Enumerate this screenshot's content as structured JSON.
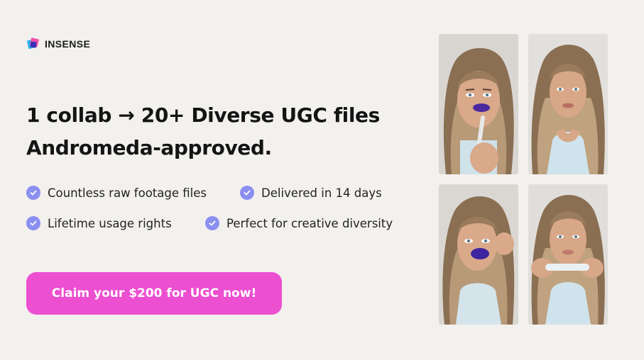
{
  "brand": {
    "name": "INSENSE"
  },
  "headline": {
    "line1": "1 collab → 20+ Diverse UGC files",
    "line2": "Andromeda-approved."
  },
  "features": [
    {
      "label": "Countless raw footage files",
      "icon": "check-circle-icon"
    },
    {
      "label": "Delivered in 14 days",
      "icon": "check-circle-icon"
    },
    {
      "label": "Lifetime usage rights",
      "icon": "check-circle-icon"
    },
    {
      "label": "Perfect for creative diversity",
      "icon": "check-circle-icon"
    }
  ],
  "cta": {
    "label": "Claim your $200 for UGC now!"
  },
  "colors": {
    "background": "#f3f1ee",
    "cta": "#ec4fd0",
    "check": "#8b8ff0",
    "text": "#141414"
  }
}
